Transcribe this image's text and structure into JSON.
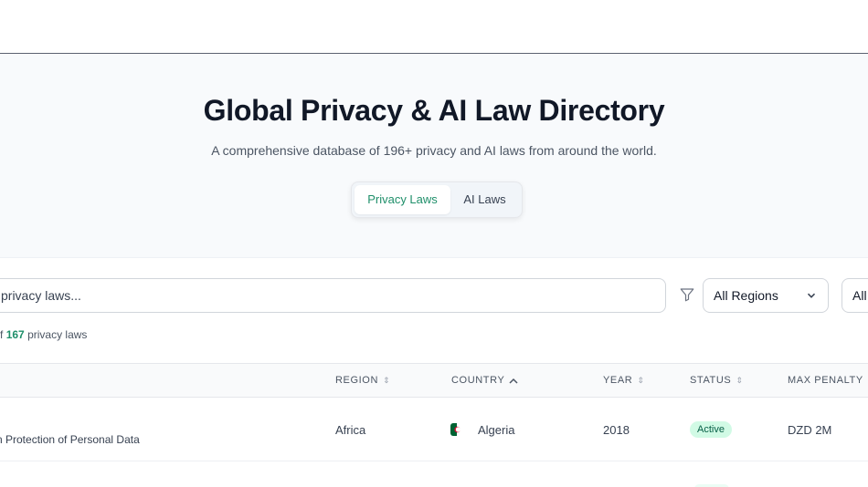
{
  "hero": {
    "title": "Global Privacy & AI Law Directory",
    "subtitle": "A comprehensive database of 196+ privacy and AI laws from around the world.",
    "tabs": [
      {
        "label": "Privacy Laws",
        "active": true
      },
      {
        "label": "AI Laws",
        "active": false
      }
    ]
  },
  "filters": {
    "search_value": "privacy laws...",
    "region_select": "All Regions",
    "second_select": "All"
  },
  "results": {
    "prefix": "f",
    "count": "167",
    "suffix": "privacy laws"
  },
  "table": {
    "columns": {
      "region": "REGION",
      "country": "COUNTRY",
      "year": "YEAR",
      "status": "STATUS",
      "max_penalty": "MAX PENALTY"
    },
    "rows": [
      {
        "law": "n Protection of Personal Data",
        "region": "Africa",
        "country": "Algeria",
        "year": "2018",
        "status": "Active",
        "max_penalty": "DZD 2M"
      }
    ]
  },
  "colors": {
    "accent": "#1f8f6a",
    "status_active_bg": "#d1fae5",
    "status_active_text": "#065f46",
    "algeria_green": "#006233",
    "algeria_red": "#d21034"
  }
}
